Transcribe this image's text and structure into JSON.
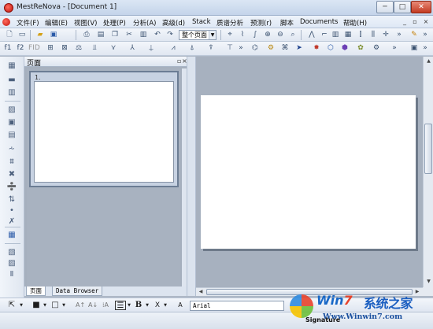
{
  "window": {
    "title": "MestReNova - [Document 1]",
    "min_label": "─",
    "max_label": "□",
    "close_label": "✕"
  },
  "menu": {
    "items": [
      "文件(F)",
      "编辑(E)",
      "视图(V)",
      "处理(P)",
      "分析(A)",
      "高级(d)",
      "Stack",
      "质谱分析",
      "预测(r)",
      "脚本",
      "Documents",
      "帮助(H)"
    ],
    "mdi_controls": [
      "_",
      "▫",
      "×"
    ]
  },
  "toolbar": {
    "page_combo": "整个页面"
  },
  "pages_panel": {
    "title": "页面",
    "float_label": "▫",
    "close_label": "×",
    "thumbnail_number": "1."
  },
  "panel_tabs": {
    "pages": "页面",
    "data_browser": "Data Browser"
  },
  "format_toolbar": {
    "font_name": "Arial",
    "bold_label": "B",
    "subscript_label": "X",
    "text_label": "A"
  },
  "status": {
    "text": "Signature"
  },
  "watermark": {
    "brand_win": "Win",
    "brand_seven": "7",
    "brand_cn": "系统之家",
    "url": "Www.Winwin7.com"
  },
  "colors": {
    "accent": "#1868c7",
    "workspace": "#a7b1bf",
    "close_button": "#c33b22"
  }
}
